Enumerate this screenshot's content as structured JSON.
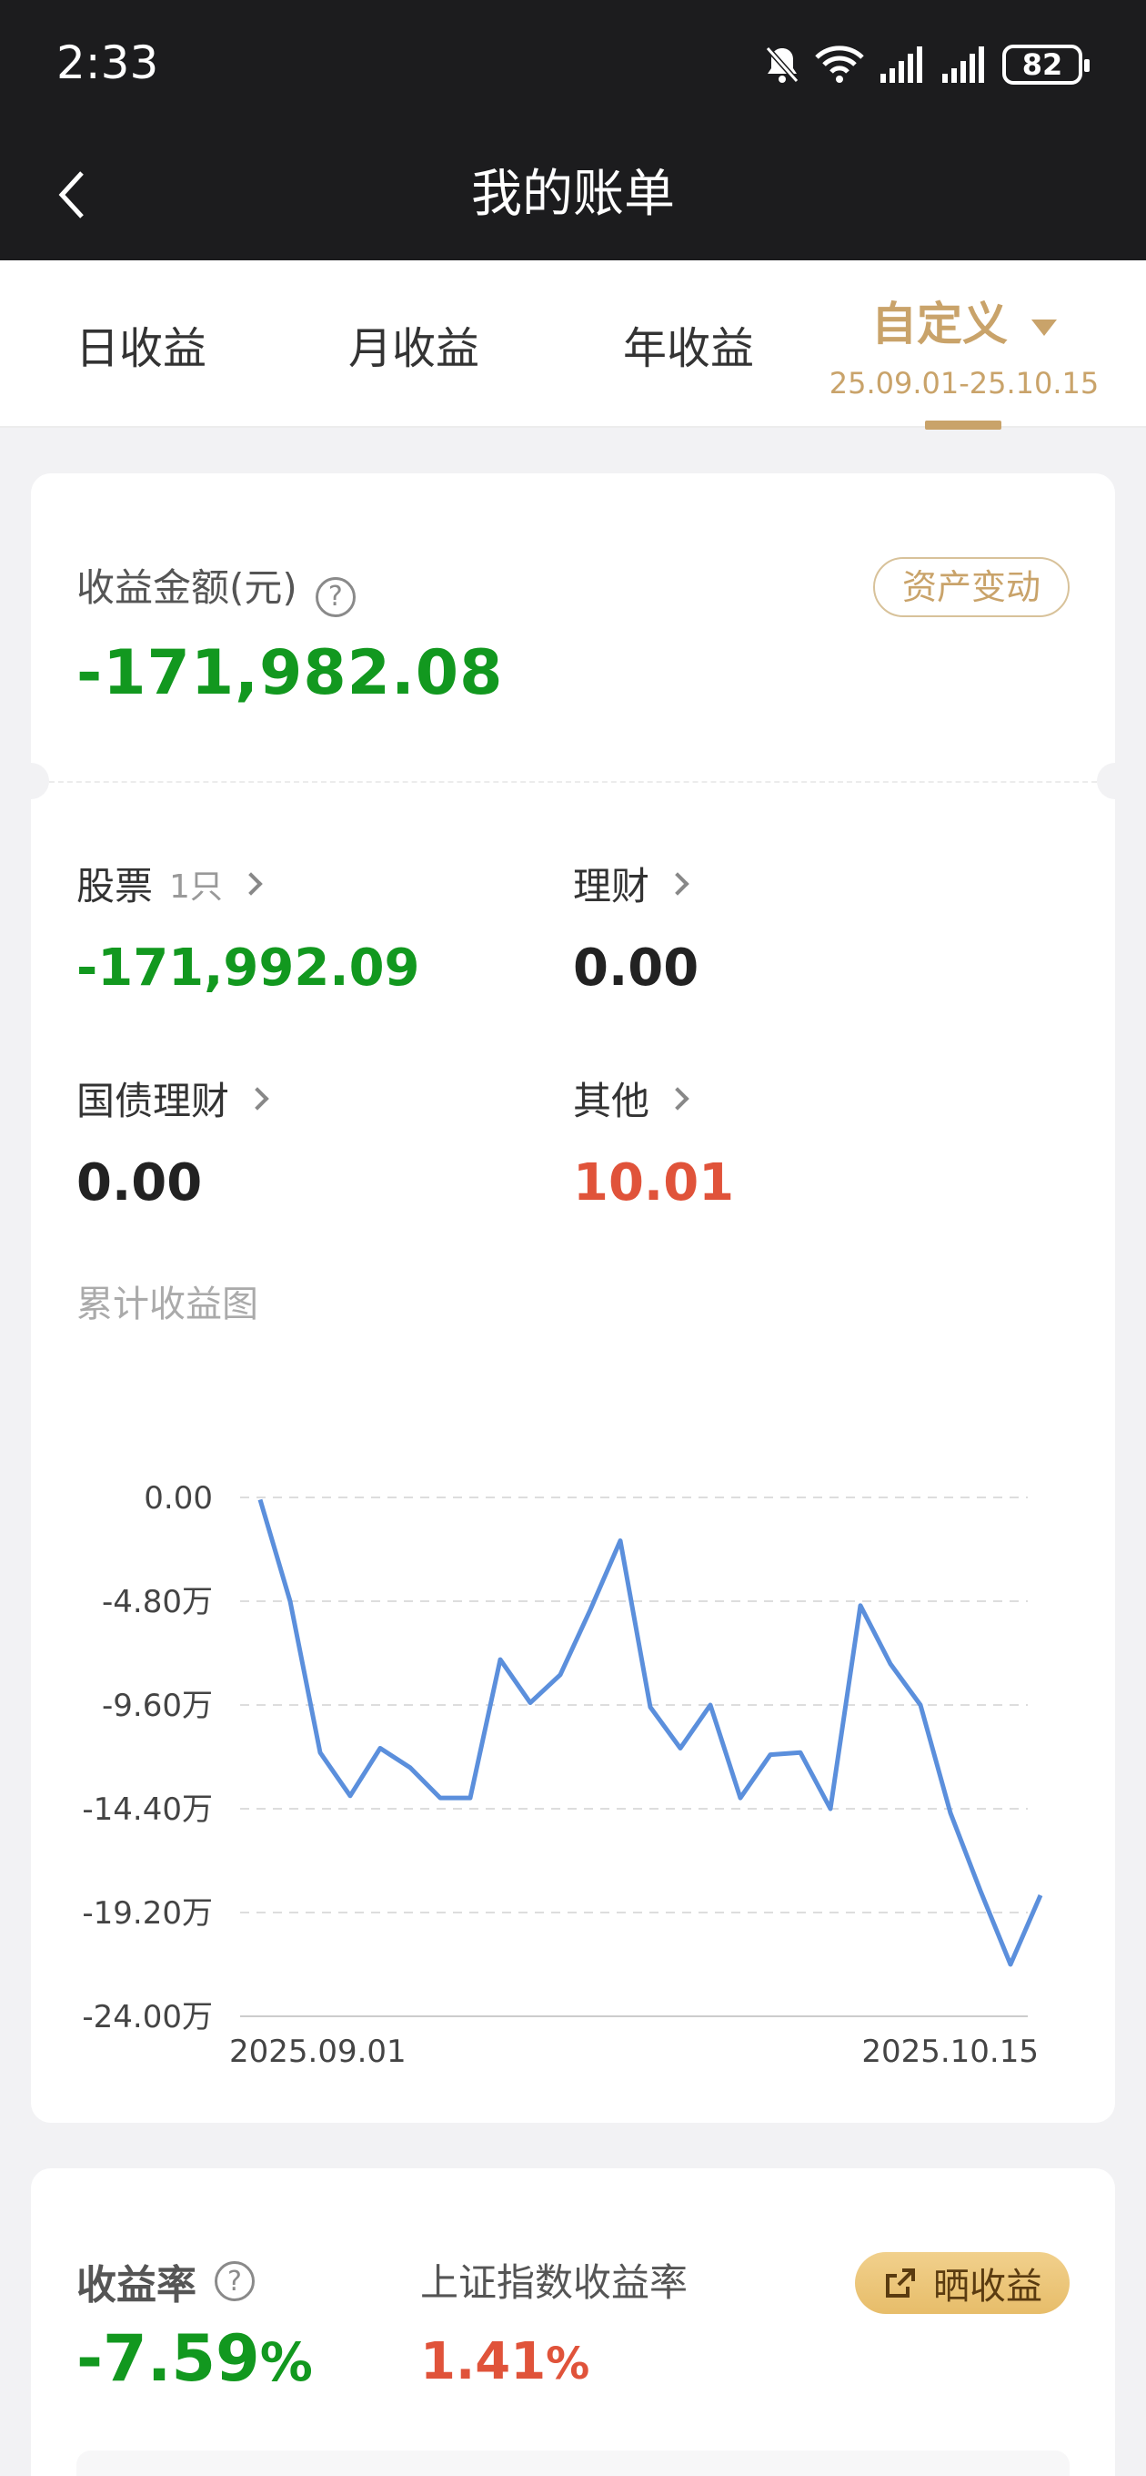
{
  "status_bar": {
    "time": "2:33",
    "battery": "82"
  },
  "nav": {
    "title": "我的账单"
  },
  "tabs": [
    {
      "label": "日收益"
    },
    {
      "label": "月收益"
    },
    {
      "label": "年收益"
    },
    {
      "label": "自定义",
      "sub": "25.09.01-25.10.15"
    }
  ],
  "summary": {
    "amount_label": "收益金额(元)",
    "amount": "-171,982.08",
    "asset_change_button": "资产变动"
  },
  "breakdown": [
    {
      "label": "股票",
      "sub": "1只",
      "value": "-171,992.09"
    },
    {
      "label": "理财",
      "value": "0.00"
    },
    {
      "label": "国债理财",
      "value": "0.00"
    },
    {
      "label": "其他",
      "value": "10.01"
    }
  ],
  "chart_section": {
    "title": "累计收益图"
  },
  "chart_data": {
    "type": "line",
    "x_start_label": "2025.09.01",
    "x_end_label": "2025.10.15",
    "yticks": [
      "0.00",
      "-4.80万",
      "-9.60万",
      "-14.40万",
      "-19.20万",
      "-24.00万"
    ],
    "ylim": [
      -240000,
      0
    ],
    "y_unit": "元",
    "grid": true,
    "series": [
      {
        "color": "#5b8fdc",
        "values": [
          -1000,
          -48000,
          -118000,
          -138000,
          -116000,
          -125000,
          -139000,
          -139000,
          -75000,
          -95000,
          -82000,
          -52000,
          -20000,
          -97000,
          -116000,
          -96000,
          -139000,
          -119000,
          -118000,
          -144000,
          -50000,
          -77000,
          -96000,
          -146000,
          -182000,
          -216000,
          -184000
        ]
      }
    ]
  },
  "returns": {
    "rate_label": "收益率",
    "rate_value": "-7.59",
    "rate_unit": "%",
    "index_label": "上证指数收益率",
    "index_value": "1.41",
    "index_unit": "%",
    "share_button": "晒收益"
  },
  "colors": {
    "accent_gold": "#c9a36a",
    "loss_green": "#12981f",
    "gain_red": "#e0533a",
    "line_blue": "#5b8fdc"
  }
}
